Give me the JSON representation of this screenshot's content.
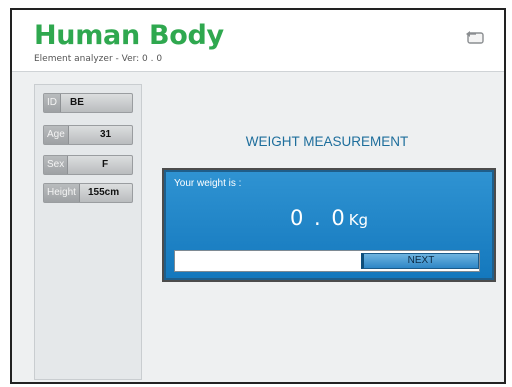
{
  "header": {
    "title": "Human Body",
    "subtitle": "Element analyzer - Ver: 0 . 0",
    "back_icon": "back-icon"
  },
  "sidebar": {
    "fields": [
      {
        "label": "ID",
        "value": "BE"
      },
      {
        "label": "Age",
        "value": "31"
      },
      {
        "label": "Sex",
        "value": "F"
      },
      {
        "label": "Height",
        "value": "155cm"
      }
    ]
  },
  "main": {
    "title": "WEIGHT MEASUREMENT",
    "panel_label": "Your weight is :",
    "weight_value": "0 . 0",
    "weight_unit": "Kg",
    "progress": 0.0,
    "next_label": "NEXT"
  },
  "colors": {
    "brand_green": "#2fa84f",
    "panel_blue": "#1478bd",
    "title_blue": "#1e6e9c"
  }
}
